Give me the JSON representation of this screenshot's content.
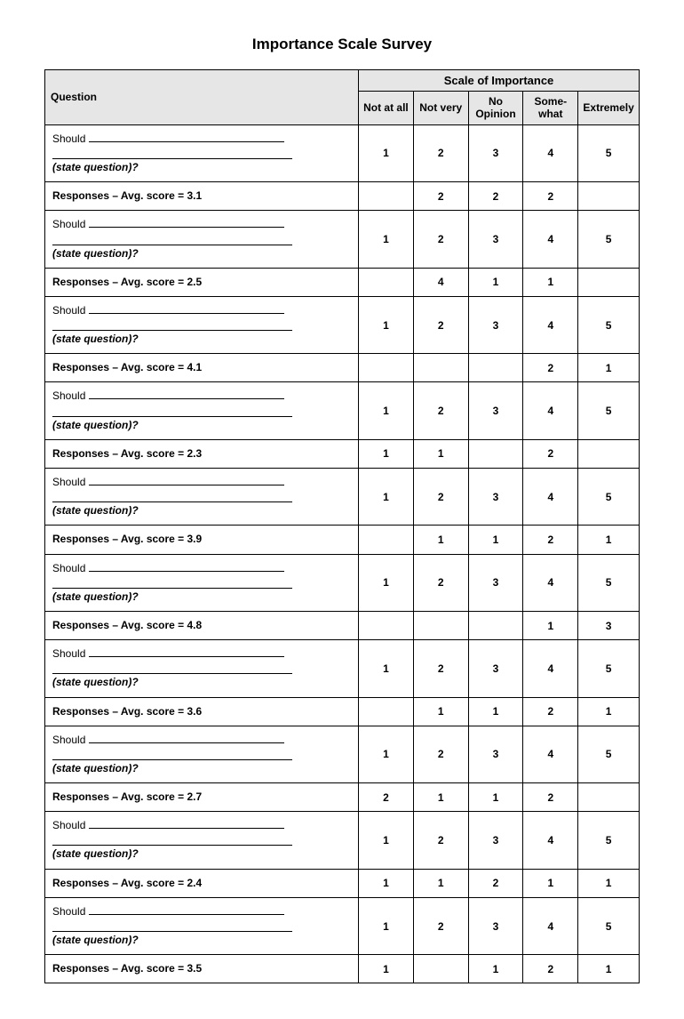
{
  "title": "Importance Scale Survey",
  "headers": {
    "question": "Question",
    "scale": "Scale of Importance",
    "cols": [
      "Not at all",
      "Not very",
      "No Opinion",
      "Some-what",
      "Extremely"
    ]
  },
  "should_label": "Should",
  "state_q": "(state question)?",
  "resp_prefix": "Responses –  Avg. score = ",
  "scale_nums": [
    "1",
    "2",
    "3",
    "4",
    "5"
  ],
  "rows": [
    {
      "avg": "3.1",
      "r": [
        "",
        "2",
        "2",
        "2",
        ""
      ]
    },
    {
      "avg": "2.5",
      "r": [
        "",
        "4",
        "1",
        "1",
        ""
      ]
    },
    {
      "avg": "4.1",
      "r": [
        "",
        "",
        "",
        "2",
        "1"
      ]
    },
    {
      "avg": "2.3",
      "r": [
        "1",
        "1",
        "",
        "2",
        ""
      ]
    },
    {
      "avg": "3.9",
      "r": [
        "",
        "1",
        "1",
        "2",
        "1"
      ]
    },
    {
      "avg": "4.8",
      "r": [
        "",
        "",
        "",
        "1",
        "3"
      ]
    },
    {
      "avg": "3.6",
      "r": [
        "",
        "1",
        "1",
        "2",
        "1"
      ]
    },
    {
      "avg": "2.7",
      "r": [
        "2",
        "1",
        "1",
        "2",
        ""
      ]
    },
    {
      "avg": "2.4",
      "r": [
        "1",
        "1",
        "2",
        "1",
        "1"
      ]
    },
    {
      "avg": "3.5",
      "r": [
        "1",
        "",
        "1",
        "2",
        "1"
      ]
    }
  ]
}
